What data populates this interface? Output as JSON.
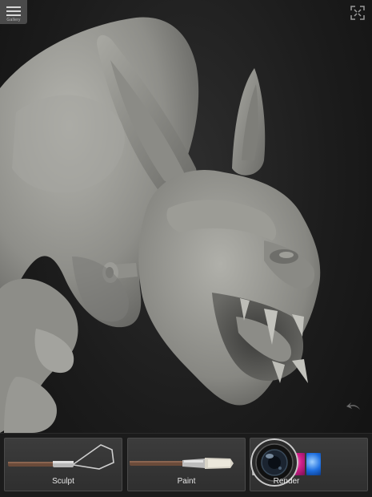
{
  "app": {
    "menu_caption": "Gallery"
  },
  "toolbar": {
    "sculpt_label": "Sculpt",
    "paint_label": "Paint",
    "render_label": "Render"
  },
  "icons": {
    "menu": "hamburger-menu-icon",
    "fullscreen": "fullscreen-icon",
    "undo": "undo-icon"
  },
  "colors": {
    "background": "#1c1c1c",
    "model": "#9a9a94",
    "panel": "#363636",
    "render_swatch_1": "#dcdcdc",
    "render_swatch_2": "#e01010",
    "render_swatch_3": "#d0208a",
    "render_swatch_4": "#1e6fe0"
  }
}
